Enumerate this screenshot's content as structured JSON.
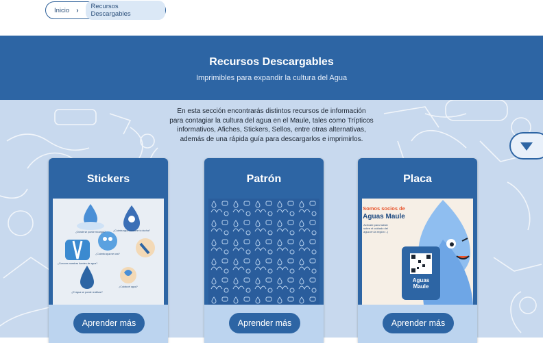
{
  "breadcrumb": {
    "home": "Inicio",
    "separator": "›",
    "current": "Recursos Descargables"
  },
  "banner": {
    "title": "Recursos Descargables",
    "subtitle": "Imprimibles para expandir la cultura del Agua"
  },
  "intro": {
    "lines": [
      "En esta sección encontrarás distintos recursos de información",
      "para contagiar la cultura del agua en el Maule, tales como Trípticos",
      "informativos, Afiches, Stickers, Sellos, entre otras alternativas,",
      "además de una rápida guía para descargarlos e imprimirlos."
    ]
  },
  "scroll_button": {
    "icon": "triangle-down-icon"
  },
  "cards": [
    {
      "title": "Stickers",
      "button": "Aprender más"
    },
    {
      "title": "Patrón",
      "button": "Aprender más"
    },
    {
      "title": "Placa",
      "button": "Aprender más"
    }
  ],
  "placa_image": {
    "heading": "Somos socios de",
    "brand": "Aguas Maule",
    "body_lines": [
      "Actívate para hablar",
      "sobre el cuidado del",
      "agua en la región :-)"
    ],
    "sign_line1": "Aguas",
    "sign_line2": "Maule"
  },
  "sticker_labels": [
    "¿Dónde se puede recargar?",
    "¿Cuánta agua consume tu ducha?",
    "¿Conoces nuestras fuentes de agua?",
    "¿Cuánta agua se usa?",
    "¿El agua se puede reutilizar?",
    "¿Cuidas el agua?"
  ],
  "colors": {
    "primary": "#2d65a4",
    "background": "#c8d9ee",
    "card_footer": "#bcd4ef",
    "accent_orange": "#e8542c"
  }
}
